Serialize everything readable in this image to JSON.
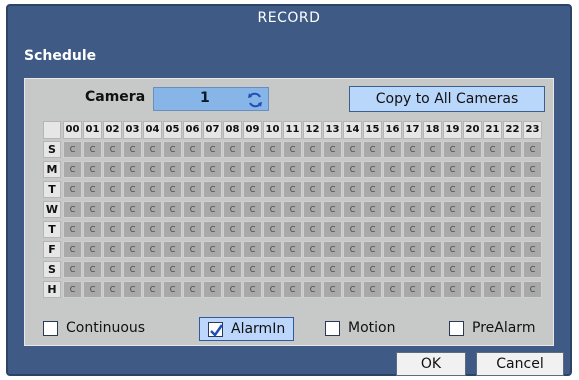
{
  "window": {
    "title": "RECORD",
    "section_title": "Schedule"
  },
  "camera": {
    "label": "Camera",
    "value": "1"
  },
  "copy_button": {
    "label": "Copy to All Cameras"
  },
  "schedule": {
    "hours": [
      "00",
      "01",
      "02",
      "03",
      "04",
      "05",
      "06",
      "07",
      "08",
      "09",
      "10",
      "11",
      "12",
      "13",
      "14",
      "15",
      "16",
      "17",
      "18",
      "19",
      "20",
      "21",
      "22",
      "23"
    ],
    "days": [
      "S",
      "M",
      "T",
      "W",
      "T",
      "F",
      "S",
      "H"
    ],
    "cell_value": "C"
  },
  "legend": {
    "items": [
      {
        "label": "Continuous",
        "checked": false
      },
      {
        "label": "AlarmIn",
        "checked": true
      },
      {
        "label": "Motion",
        "checked": false
      },
      {
        "label": "PreAlarm",
        "checked": false
      }
    ]
  },
  "buttons": {
    "ok": "OK",
    "cancel": "Cancel"
  },
  "colors": {
    "window_bg": "#3f5a84",
    "panel_bg": "#c7c8c8",
    "cell_bg": "#a9a9a9",
    "camera_field": "#87b5e8",
    "copy_button": "#b9d6fb"
  },
  "icons": {
    "camera_cycle": "refresh-icon",
    "checkmark": "checkmark-icon"
  }
}
